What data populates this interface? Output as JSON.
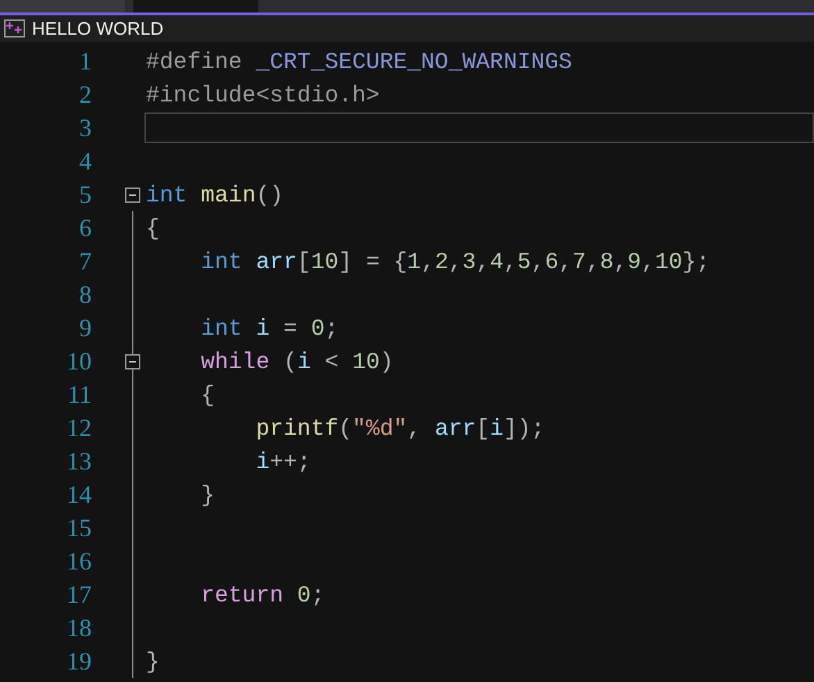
{
  "tabs": [
    {
      "selected": false
    },
    {
      "selected": true
    }
  ],
  "document": {
    "title": "HELLO WORLD"
  },
  "lines": [
    {
      "number": "1",
      "current": false,
      "tokens": [
        {
          "kind": "preprocessor",
          "text": "#define"
        },
        {
          "kind": "macro",
          "text": " _CRT_SECURE_NO_WARNINGS"
        }
      ]
    },
    {
      "number": "2",
      "current": false,
      "tokens": [
        {
          "kind": "preprocessor",
          "text": "#include<stdio.h>"
        }
      ]
    },
    {
      "number": "3",
      "current": true
    },
    {
      "number": "4",
      "current": false
    },
    {
      "number": "5",
      "current": false,
      "expanded": true,
      "tokens": [
        {
          "kind": "keyword",
          "text": "int"
        },
        {
          "kind": "function",
          "text": " main"
        },
        {
          "kind": "punct",
          "text": "()"
        }
      ]
    },
    {
      "number": "6",
      "current": false,
      "tokens": [
        {
          "kind": "punct",
          "text": "{"
        }
      ]
    },
    {
      "number": "7",
      "current": false,
      "tokens": [
        {
          "kind": "keyword",
          "text": "    int"
        },
        {
          "kind": "variable",
          "text": " arr"
        },
        {
          "kind": "punct",
          "text": "["
        },
        {
          "kind": "number",
          "text": "10"
        },
        {
          "kind": "punct",
          "text": "] = {"
        },
        {
          "kind": "number",
          "text": "1"
        },
        {
          "kind": "punct",
          "text": ","
        },
        {
          "kind": "number",
          "text": "2"
        },
        {
          "kind": "punct",
          "text": ","
        },
        {
          "kind": "number",
          "text": "3"
        },
        {
          "kind": "punct",
          "text": ","
        },
        {
          "kind": "number",
          "text": "4"
        },
        {
          "kind": "punct",
          "text": ","
        },
        {
          "kind": "number",
          "text": "5"
        },
        {
          "kind": "punct",
          "text": ","
        },
        {
          "kind": "number",
          "text": "6"
        },
        {
          "kind": "punct",
          "text": ","
        },
        {
          "kind": "number",
          "text": "7"
        },
        {
          "kind": "punct",
          "text": ","
        },
        {
          "kind": "number",
          "text": "8"
        },
        {
          "kind": "punct",
          "text": ","
        },
        {
          "kind": "number",
          "text": "9"
        },
        {
          "kind": "punct",
          "text": ","
        },
        {
          "kind": "number",
          "text": "10"
        },
        {
          "kind": "punct",
          "text": "};"
        }
      ]
    },
    {
      "number": "8",
      "current": false
    },
    {
      "number": "9",
      "current": false,
      "tokens": [
        {
          "kind": "keyword",
          "text": "    int"
        },
        {
          "kind": "variable",
          "text": " i"
        },
        {
          "kind": "punct",
          "text": " = "
        },
        {
          "kind": "number",
          "text": "0"
        },
        {
          "kind": "punct",
          "text": ";"
        }
      ]
    },
    {
      "number": "10",
      "current": false,
      "expanded": true,
      "tokens": [
        {
          "kind": "control",
          "text": "    while"
        },
        {
          "kind": "punct",
          "text": " ("
        },
        {
          "kind": "variable",
          "text": "i"
        },
        {
          "kind": "punct",
          "text": " < "
        },
        {
          "kind": "number",
          "text": "10"
        },
        {
          "kind": "punct",
          "text": ")"
        }
      ]
    },
    {
      "number": "11",
      "current": false,
      "tokens": [
        {
          "kind": "punct",
          "text": "    {"
        }
      ]
    },
    {
      "number": "12",
      "current": false,
      "tokens": [
        {
          "kind": "function",
          "text": "        printf"
        },
        {
          "kind": "punct",
          "text": "("
        },
        {
          "kind": "string",
          "text": "\"%d\""
        },
        {
          "kind": "punct",
          "text": ", "
        },
        {
          "kind": "variable",
          "text": "arr"
        },
        {
          "kind": "punct",
          "text": "["
        },
        {
          "kind": "variable",
          "text": "i"
        },
        {
          "kind": "punct",
          "text": "]);"
        }
      ]
    },
    {
      "number": "13",
      "current": false,
      "tokens": [
        {
          "kind": "variable",
          "text": "        i"
        },
        {
          "kind": "punct",
          "text": "++;"
        }
      ]
    },
    {
      "number": "14",
      "current": false,
      "tokens": [
        {
          "kind": "punct",
          "text": "    }"
        }
      ]
    },
    {
      "number": "15",
      "current": false
    },
    {
      "number": "16",
      "current": false
    },
    {
      "number": "17",
      "current": false,
      "tokens": [
        {
          "kind": "control",
          "text": "    return"
        },
        {
          "kind": "number",
          "text": " 0"
        },
        {
          "kind": "punct",
          "text": ";"
        }
      ]
    },
    {
      "number": "18",
      "current": false
    },
    {
      "number": "19",
      "current": false,
      "tokens": [
        {
          "kind": "punct",
          "text": "}"
        }
      ]
    }
  ]
}
